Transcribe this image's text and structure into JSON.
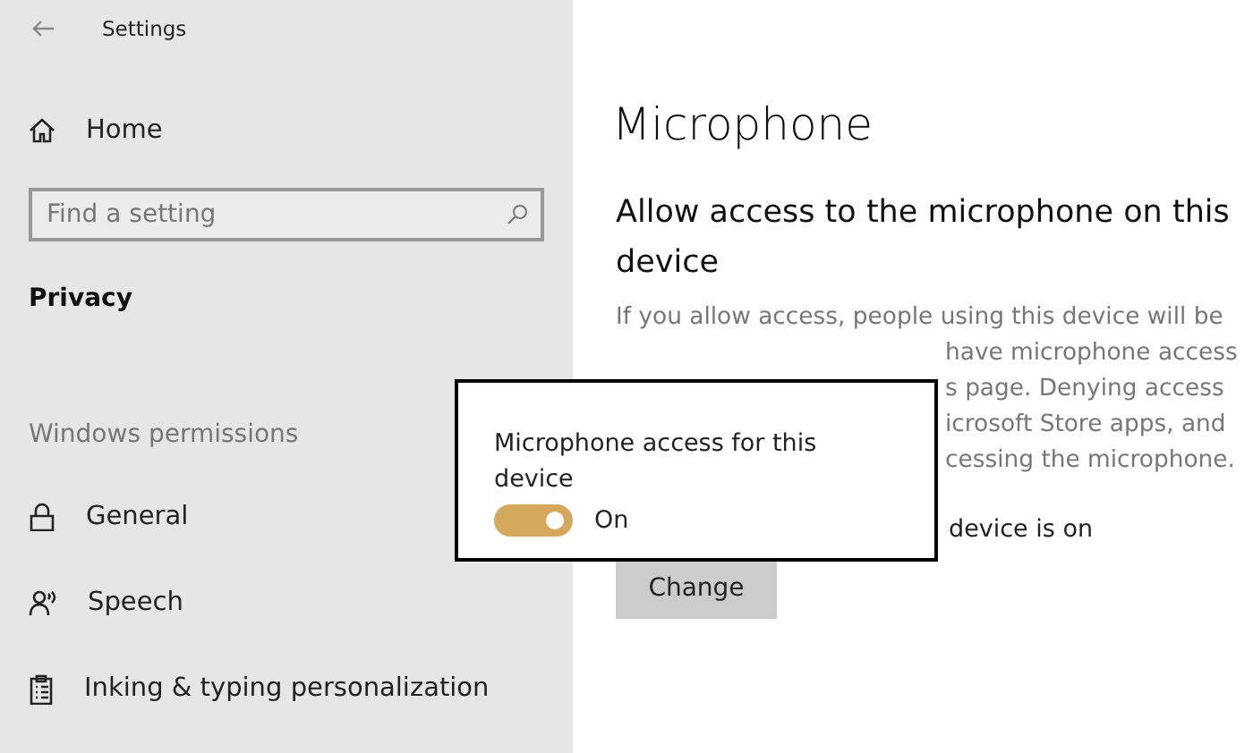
{
  "window": {
    "title": "Settings"
  },
  "sidebar": {
    "home": "Home",
    "search": {
      "placeholder": "Find a setting"
    },
    "section": "Privacy",
    "group": "Windows permissions",
    "items": [
      {
        "label": "General"
      },
      {
        "label": "Speech"
      },
      {
        "label": "Inking & typing personalization"
      }
    ]
  },
  "main": {
    "title": "Microphone",
    "heading": "Allow access to the microphone on this device",
    "paragraph_lines": [
      "If you allow access, people using this device will be",
      "have microphone access",
      "s page. Denying access",
      "icrosoft Store apps, and",
      "cessing the microphone."
    ],
    "status": "device is on",
    "button": "Change"
  },
  "popup": {
    "title": "Microphone access for this device",
    "toggle": {
      "on": true,
      "label": "On"
    }
  }
}
